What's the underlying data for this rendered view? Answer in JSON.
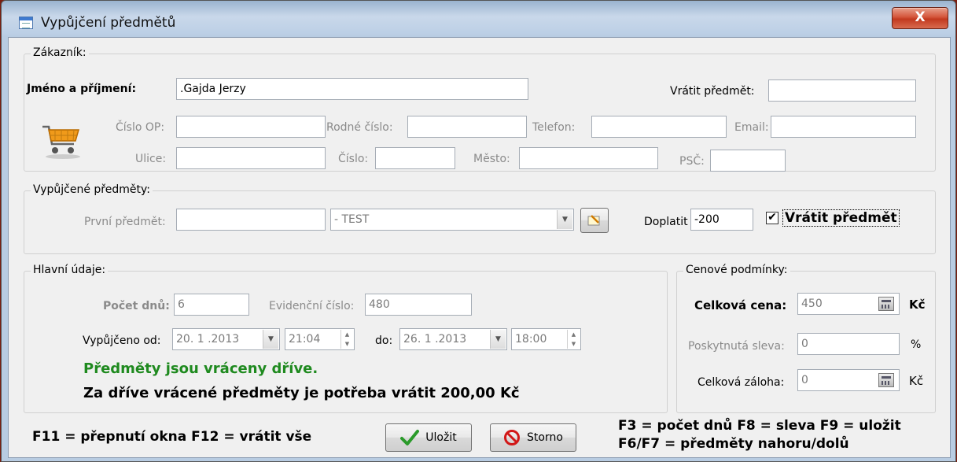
{
  "window": {
    "title": "Vypůjčení předmětů",
    "close_label": "X"
  },
  "customer": {
    "legend": "Zákazník:",
    "name_label": "Jméno a příjmení:",
    "name_value": ".Gajda Jerzy",
    "return_label": "Vrátit předmět:",
    "return_value": "",
    "op_label": "Číslo OP:",
    "op_value": "",
    "rc_label": "Rodné číslo:",
    "rc_value": "",
    "phone_label": "Telefon:",
    "phone_value": "",
    "email_label": "Email:",
    "email_value": "",
    "street_label": "Ulice:",
    "street_value": "",
    "number_label": "Číslo:",
    "number_value": "",
    "city_label": "Město:",
    "city_value": "",
    "zip_label": "PSČ:",
    "zip_value": ""
  },
  "items": {
    "legend": "Vypůjčené předměty:",
    "first_label": "První předmět:",
    "first_value": "",
    "combo_value": "- TEST",
    "doplatit_label": "Doplatit",
    "doplatit_value": "-200",
    "return_check_label": "Vrátit předmět",
    "return_checked": "✔"
  },
  "main": {
    "legend": "Hlavní údaje:",
    "days_label": "Počet dnů:",
    "days_value": "6",
    "evid_label": "Evidenční číslo:",
    "evid_value": "480",
    "from_label": "Vypůjčeno od:",
    "from_date": "20. 1 .2013",
    "from_time": "21:04",
    "to_label": "do:",
    "to_date": "26. 1 .2013",
    "to_time": "18:00",
    "status_green": "Předměty jsou vráceny dříve.",
    "status_black": "Za dříve vrácené předměty je potřeba vrátit 200,00 Kč"
  },
  "price": {
    "legend": "Cenové podmínky:",
    "total_label": "Celková cena:",
    "total_value": "450",
    "total_unit": "Kč",
    "discount_label": "Poskytnutá sleva:",
    "discount_value": "0",
    "discount_unit": "%",
    "deposit_label": "Celková záloha:",
    "deposit_value": "0",
    "deposit_unit": "Kč"
  },
  "footer": {
    "hint_left": "F11 = přepnutí okna  F12 = vrátit vše",
    "save_label": "Uložit",
    "cancel_label": "Storno",
    "hint_right_1": "F3 = počet dnů  F8 = sleva  F9 = uložit",
    "hint_right_2": "F6/F7 = předměty nahoru/dolů"
  },
  "colors": {
    "status_green": "#1f8a1f",
    "close_red": "#c23a1f"
  }
}
